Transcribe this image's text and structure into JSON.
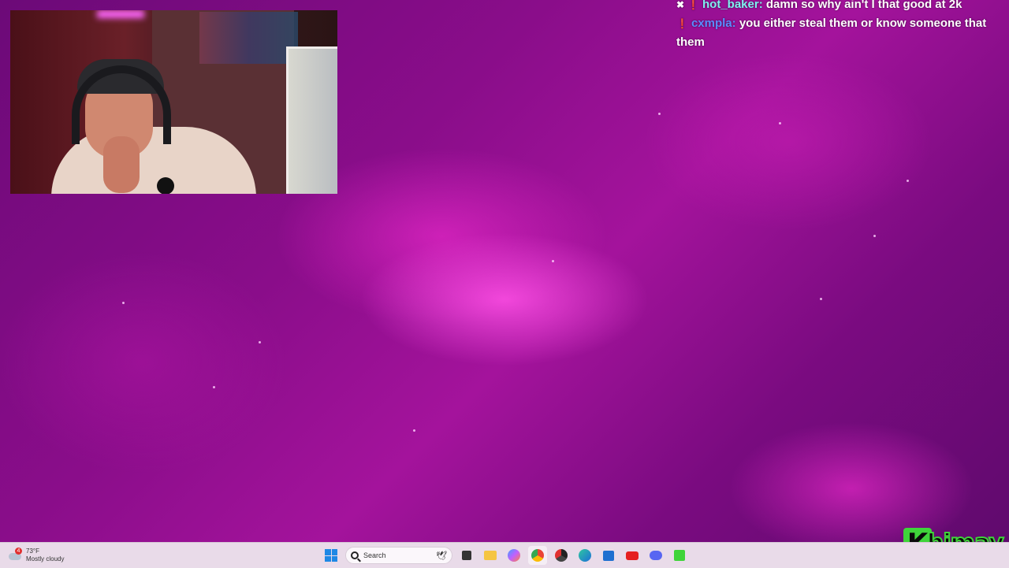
{
  "chat": {
    "messages": [
      {
        "user": "hot_baker",
        "separator": ":",
        "text": "damn so why ain't I that good at 2k"
      },
      {
        "user": "cxmpla",
        "separator": ":",
        "text": "you either steal them or know someone that",
        "continuation": "them"
      }
    ]
  },
  "overlay_logo": {
    "letter": "K",
    "text": "himay"
  },
  "taskbar": {
    "weather": {
      "temperature": "73°F",
      "condition": "Mostly cloudy",
      "alert_count": "4"
    },
    "search_placeholder": "Search",
    "pinned_apps": [
      "task-view",
      "file-explorer",
      "copilot",
      "chrome",
      "chrome-beta",
      "edge",
      "microsoft-store",
      "youtube",
      "discord",
      "kick"
    ]
  },
  "colors": {
    "background": "#8a0d8a",
    "taskbar": "#e9dbe9",
    "username_1": "#7ff0f0",
    "username_2": "#5a8cff",
    "logo_green": "#3fd43a"
  }
}
